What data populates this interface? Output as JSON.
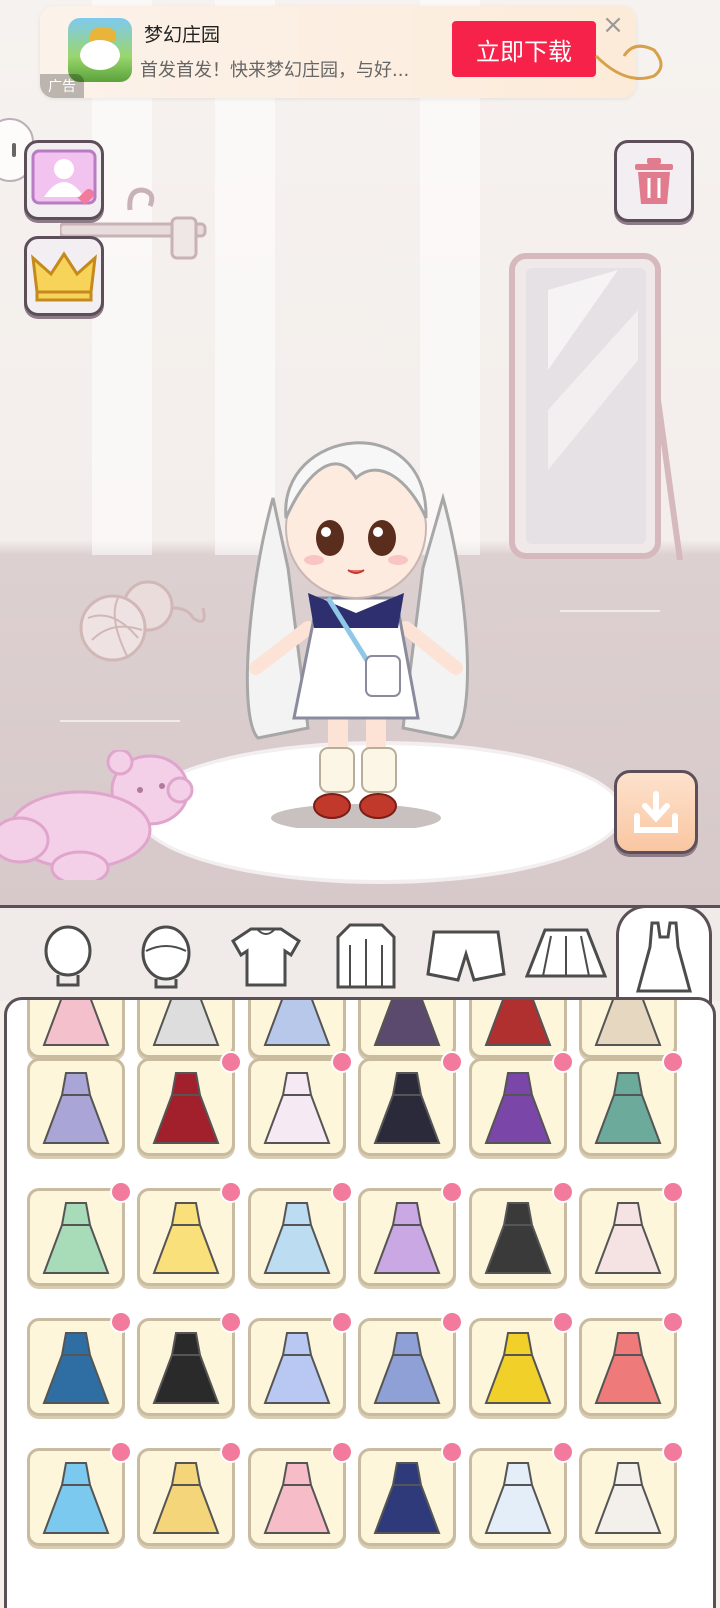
{
  "ad": {
    "app_title": "梦幻庄园",
    "app_desc": "首发首发！快来梦幻庄园，与好...",
    "download_label": "立即下载",
    "ad_tag": "广告",
    "close_icon": "close-icon"
  },
  "scene_buttons": {
    "left": [
      "photo-frame-icon",
      "crown-icon"
    ],
    "right_top": "trash-icon",
    "right_bottom": "download-icon",
    "pause": "pause-icon"
  },
  "tabs": [
    {
      "name": "face-tab",
      "icon": "face-icon",
      "active": false
    },
    {
      "name": "hair-tab",
      "icon": "hair-icon",
      "active": false
    },
    {
      "name": "top-tab",
      "icon": "tshirt-icon",
      "active": false
    },
    {
      "name": "coat-tab",
      "icon": "jacket-icon",
      "active": false
    },
    {
      "name": "shorts-tab",
      "icon": "shorts-icon",
      "active": false
    },
    {
      "name": "skirt-tab",
      "icon": "skirt-icon",
      "active": false
    },
    {
      "name": "dress-tab",
      "icon": "dress-icon",
      "active": true
    }
  ],
  "colors": {
    "accent_badge": "#f27a9c",
    "download_button": "#f7224a",
    "item_bg": "#fdf6da"
  },
  "dress_items": [
    [
      "#f4c0cc",
      "#dddddd",
      "#b7c8ea",
      "#5b4a6e",
      "#b03030",
      "#e6d7c0"
    ],
    [
      "#a9a5d6",
      "#a2202c",
      "#f5e9f3",
      "#2a2a3a",
      "#7a47a8",
      "#6cab9b"
    ],
    [
      "#a8dcb9",
      "#fae07a",
      "#bcdcf2",
      "#c9a8e3",
      "#3a3a3a",
      "#f5e3e3"
    ],
    [
      "#2f6ea3",
      "#2a2a2a",
      "#b9c8f3",
      "#8fa0d6",
      "#f2d02a",
      "#ef7a7a"
    ],
    [
      "#7cc9ef",
      "#f5d57a",
      "#f6bdc8",
      "#2e3a7a",
      "#e4eef9",
      "#f3f0ec"
    ]
  ]
}
